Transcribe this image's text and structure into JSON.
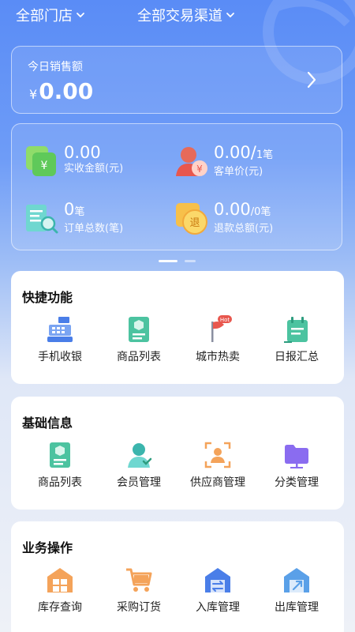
{
  "header": {
    "store_filter": "全部门店",
    "channel_filter": "全部交易渠道"
  },
  "sales": {
    "label": "今日销售额",
    "currency": "¥",
    "amount": "0.00"
  },
  "stats": {
    "received": {
      "value": "0.00",
      "caption": "实收金额(元)"
    },
    "avg_price": {
      "value": "0.00/",
      "unit": "1笔",
      "caption": "客单价(元)"
    },
    "orders": {
      "value": "0",
      "unit": "笔",
      "caption": "订单总数(笔)"
    },
    "refunds": {
      "value": "0.00",
      "unit": "/0笔",
      "caption": "退款总额(元)"
    }
  },
  "pager": {
    "pages": 2,
    "active": 1
  },
  "quick": {
    "title": "快捷功能",
    "items": [
      {
        "label": "手机收银",
        "icon": "cash-register-icon"
      },
      {
        "label": "商品列表",
        "icon": "product-list-icon"
      },
      {
        "label": "城市热卖",
        "icon": "hot-flag-icon",
        "badge": "Hot"
      },
      {
        "label": "日报汇总",
        "icon": "daily-report-icon"
      }
    ]
  },
  "basic": {
    "title": "基础信息",
    "items": [
      {
        "label": "商品列表",
        "icon": "product-list-icon"
      },
      {
        "label": "会员管理",
        "icon": "member-icon"
      },
      {
        "label": "供应商管理",
        "icon": "supplier-icon"
      },
      {
        "label": "分类管理",
        "icon": "category-folder-icon"
      }
    ]
  },
  "ops": {
    "title": "业务操作",
    "items": [
      {
        "label": "库存查询",
        "icon": "inventory-icon"
      },
      {
        "label": "采购订货",
        "icon": "cart-icon"
      },
      {
        "label": "入库管理",
        "icon": "stock-in-icon"
      },
      {
        "label": "出库管理",
        "icon": "stock-out-icon"
      }
    ]
  },
  "colors": {
    "primary": "#5a8cf6",
    "green": "#4cc3a0",
    "orange": "#f4a35a",
    "red": "#e8574e",
    "purple": "#8a6cf0",
    "blue": "#4a7ee8"
  }
}
